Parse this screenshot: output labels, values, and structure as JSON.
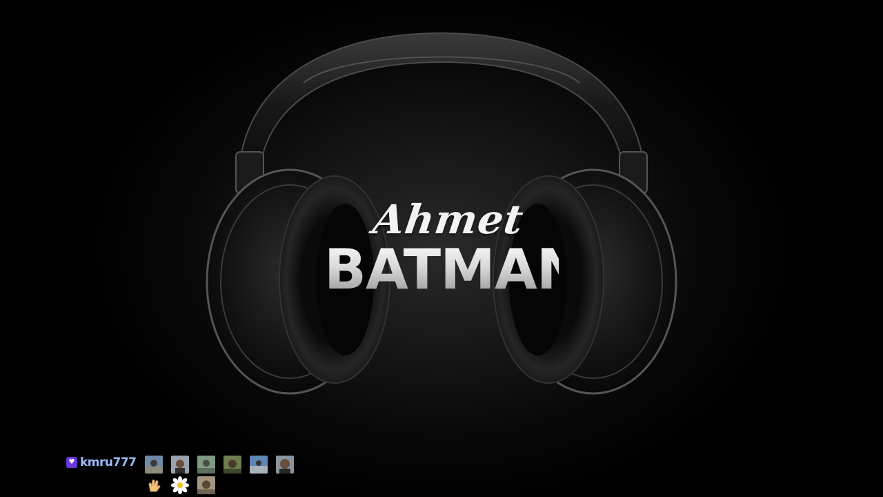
{
  "logo": {
    "script_text": "Ahmet",
    "block_text": "BATMAN"
  },
  "chat": {
    "badge_icon": "heart-badge-icon",
    "username": "kmru777",
    "username_color": "#9bbcff",
    "emotes_row1": [
      "emote-icon",
      "emote-icon",
      "emote-icon",
      "emote-icon",
      "emote-icon",
      "emote-icon"
    ],
    "emotes_row2": [
      "waving-hand-emoji",
      "daisy-flower-emoji",
      "emote-icon"
    ]
  }
}
